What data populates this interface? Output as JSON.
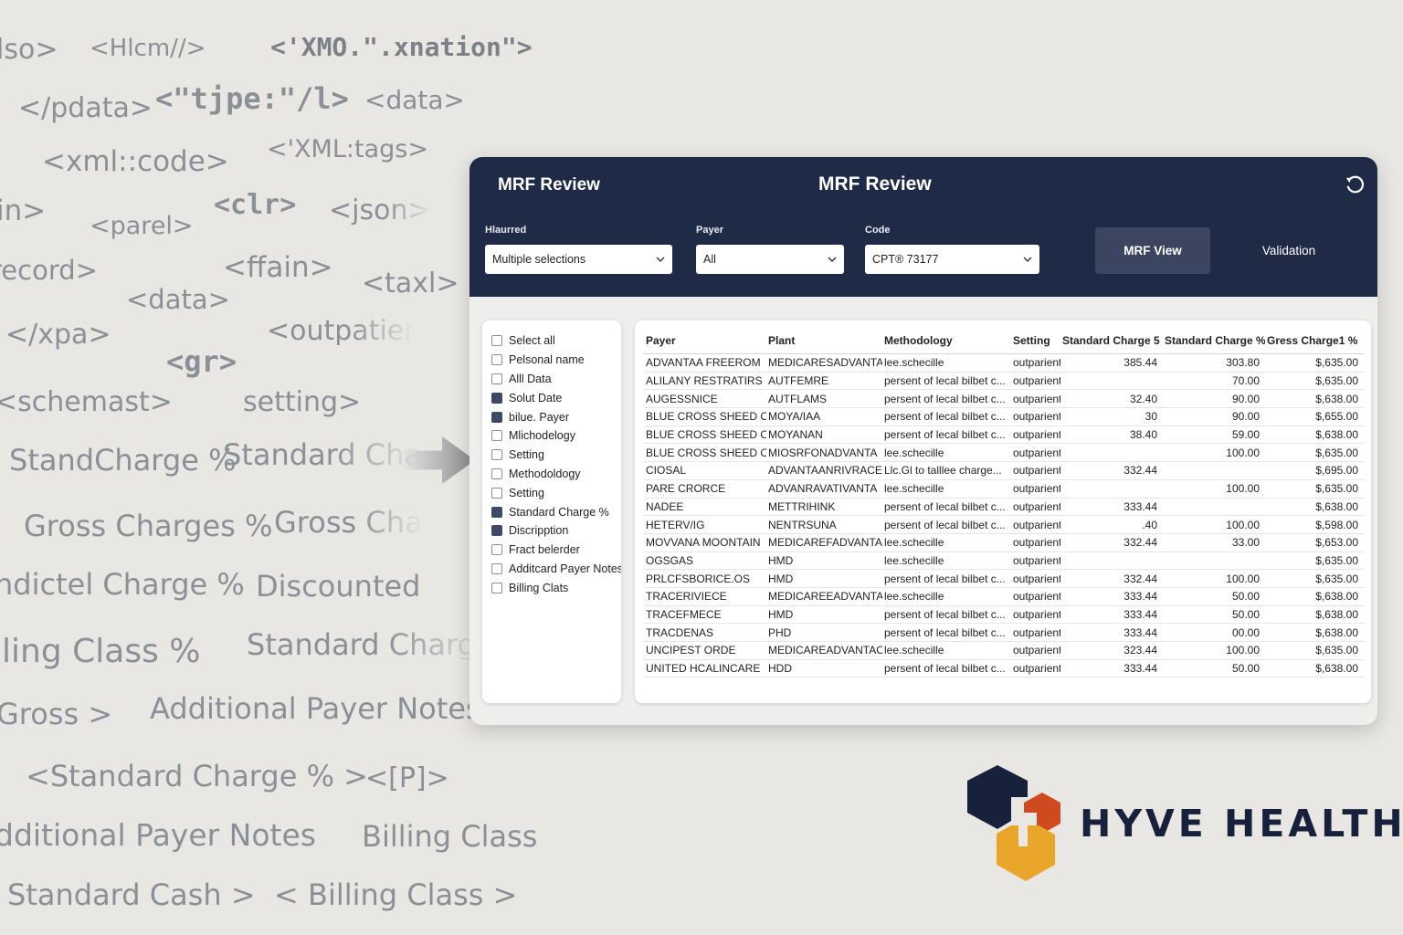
{
  "background_words": [
    {
      "text": "lso>",
      "mono": false
    },
    {
      "text": "<Hlcm//>",
      "mono": false
    },
    {
      "text": "<'XMO.\".xnation\">",
      "mono": true
    },
    {
      "text": "</pdata>",
      "mono": false
    },
    {
      "text": "<\"tjpe:\"/l>",
      "mono": true
    },
    {
      "text": "<data>",
      "mono": false
    },
    {
      "text": "<xml::code>",
      "mono": false
    },
    {
      "text": "<'XML:tags>",
      "mono": false
    },
    {
      "text": "in>",
      "mono": false
    },
    {
      "text": "<parel>",
      "mono": false
    },
    {
      "text": "<clr>",
      "mono": true
    },
    {
      "text": "<json>",
      "mono": false
    },
    {
      "text": "record>",
      "mono": false
    },
    {
      "text": "<ffain>",
      "mono": false
    },
    {
      "text": "<taxl>",
      "mono": false
    },
    {
      "text": "<data>",
      "mono": false
    },
    {
      "text": "</xpa>",
      "mono": false
    },
    {
      "text": "<outpatier",
      "mono": false
    },
    {
      "text": "<gr>",
      "mono": true
    },
    {
      "text": "<schemast>",
      "mono": false
    },
    {
      "text": "setting>",
      "mono": false
    },
    {
      "text": "StandCharge %",
      "mono": false
    },
    {
      "text": "Standard Cha",
      "mono": false
    },
    {
      "text": "Gross Charges %",
      "mono": false
    },
    {
      "text": "Gross Cha",
      "mono": false
    },
    {
      "text": "ndictel Charge %",
      "mono": false
    },
    {
      "text": "Discounted",
      "mono": false
    },
    {
      "text": "iling Class %",
      "mono": false
    },
    {
      "text": "Standard Charge",
      "mono": false
    },
    {
      "text": "Gross >",
      "mono": false
    },
    {
      "text": "Additional Payer Notes",
      "mono": false
    },
    {
      "text": "<Standard Charge % >",
      "mono": false
    },
    {
      "text": "<[P]>",
      "mono": false
    },
    {
      "text": "dditional Payer Notes",
      "mono": false
    },
    {
      "text": "Billing Class",
      "mono": false
    },
    {
      "text": "Standard Cash >",
      "mono": false
    },
    {
      "text": "< Billing Class >",
      "mono": false
    }
  ],
  "app": {
    "title_left": "MRF Review",
    "title_center": "MRF Review",
    "filters": [
      {
        "label": "Hlaurred",
        "value": "Multiple selections"
      },
      {
        "label": "Payer",
        "value": "All"
      },
      {
        "label": "Code",
        "value": "CPT® 73177"
      }
    ],
    "mrf_view_button": "MRF View",
    "validation_button": "Validation",
    "colors": {
      "header": "#1f2a47",
      "accent": "#3b4560",
      "brand_navy": "#18213b",
      "logo_orange": "#d04a1f",
      "logo_yellow": "#e9a62a"
    }
  },
  "chooser": [
    {
      "label": "Select all",
      "checked": false
    },
    {
      "label": "Pelsonal name",
      "checked": false
    },
    {
      "label": "Alll Data",
      "checked": false
    },
    {
      "label": "Solut Date",
      "checked": true
    },
    {
      "label": "bilue. Payer",
      "checked": true
    },
    {
      "label": "Mlichodelogy",
      "checked": false
    },
    {
      "label": "Setting",
      "checked": false
    },
    {
      "label": "Methodoldogy",
      "checked": false
    },
    {
      "label": "Setting",
      "checked": false
    },
    {
      "label": "Standard Charge %",
      "checked": true
    },
    {
      "label": "Discripption",
      "checked": true
    },
    {
      "label": "Fract belerder",
      "checked": false
    },
    {
      "label": "Additcard Payer Notes",
      "checked": false
    },
    {
      "label": "Billing Clats",
      "checked": false
    }
  ],
  "table": {
    "columns": [
      "Payer",
      "Plant",
      "Methodology",
      "Setting",
      "Standard Charge 5",
      "Standard Charge %",
      "Gress Charge1  %"
    ],
    "rows": [
      [
        "ADVANTAA FREEROM",
        "MEDICARESADVANTA",
        "lee.schecille",
        "outparient",
        "385.44",
        "303.80",
        "$,635.00"
      ],
      [
        "ALILANY RESTRATIRS",
        "AUTFEMRE",
        "persent of lecal bilbet c...",
        "outparient",
        "",
        "70.00",
        "$,635.00"
      ],
      [
        "AUGESSNICE",
        "AUTFLAMS",
        "persent of lecal bilbet c...",
        "outparient",
        "32.40",
        "90.00",
        "$,638.00"
      ],
      [
        "BLUE CROSS SHEED OF",
        "MOYA/IAA",
        "persent of lecal bilbet c...",
        "outparient",
        "30",
        "90.00",
        "$,655.00"
      ],
      [
        "BLUE CROSS SHEED OF",
        "MOYANAN",
        "persent of lecal bilbet c...",
        "outparient",
        "38.40",
        "59.00",
        "$,638.00"
      ],
      [
        "BLUE CROSS SHEED OF",
        "MIOSRFONADVANTA",
        "lee.schecille",
        "outparient",
        "",
        "100.00",
        "$,635.00"
      ],
      [
        "CIOSAL",
        "ADVANTAANRIVRACE",
        "Llc.Gl to talllee charge...",
        "outparient",
        "332.44",
        "",
        "$,695.00"
      ],
      [
        "PARE CRORCE",
        "ADVANRAVATIVANTA",
        "lee.schecille",
        "outparient",
        "",
        "100.00",
        "$,635.00"
      ],
      [
        "NADEE",
        "METTRIHINK",
        "persent of lecal bilbet c...",
        "outparient",
        "333.44",
        "",
        "$,638.00"
      ],
      [
        "HETERV/IG",
        "NENTRSUNA",
        "persent of lecal bilbet c...",
        "outparient",
        ".40",
        "100.00",
        "$,598.00"
      ],
      [
        "MOVVANA MOONTAIN",
        "MEDICAREFADVANTA",
        "lee.schecille",
        "outparient",
        "332.44",
        "33.00",
        "$,653.00"
      ],
      [
        "OGSGAS",
        "HMD",
        "lee.schecille",
        "outparient",
        "",
        "",
        "$,635.00"
      ],
      [
        "PRLCFSBORICE.OS",
        "HMD",
        "persent of lecal bilbet c...",
        "outparient",
        "332.44",
        "100.00",
        "$,635.00"
      ],
      [
        "TRACERIVIECE",
        "MEDICAREEADVANTA",
        "lee.schecille",
        "outparient",
        "333.44",
        "50.00",
        "$,638.00"
      ],
      [
        "TRACEFMECE",
        "HMD",
        "persent of lecal bilbet c...",
        "outparient",
        "333.44",
        "50.00",
        "$,638.00"
      ],
      [
        "TRACDENAS",
        "PHD",
        "persent of lecal bilbet c...",
        "outparient",
        "333.44",
        "00.00",
        "$,638.00"
      ],
      [
        "UNCIPEST ORDE",
        "MEDICAREADVANTACE",
        "lee.schecille",
        "outparient",
        "323.44",
        "100.00",
        "$,635.00"
      ],
      [
        "UNITED HCALINCARE",
        "HDD",
        "persent of lecal bilbet c...",
        "outparient",
        "333.44",
        "50.00",
        "$,638.00"
      ]
    ]
  },
  "brand": {
    "name": "HYVE HEALTH",
    "icon": "hexagon-logo-icon"
  }
}
